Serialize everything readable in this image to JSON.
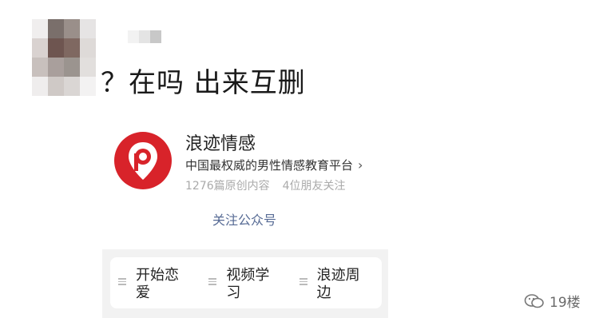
{
  "chat": {
    "message_text": "？在吗 出来互删",
    "avatar_pixels": [
      "#f0eeee",
      "#7a6f6b",
      "#9a8f8a",
      "#e6e4e4",
      "#d9d2d0",
      "#6e5550",
      "#7f6861",
      "#dedad8",
      "#c8c0bd",
      "#a99f9c",
      "#9b948f",
      "#e2dfdd",
      "#efeded",
      "#cfc9c6",
      "#dad6d4",
      "#f3f2f2"
    ],
    "name_blur_pixels": [
      "#f2f2f2",
      "#e4e4e4",
      "#c8c8c8"
    ]
  },
  "official_account": {
    "name": "浪迹情感",
    "description": "中国最权威的男性情感教育平台",
    "chevron": "›",
    "original_count": "1276篇原创内容",
    "friends_following": "4位朋友关注",
    "follow_label": "关注公众号",
    "logo_icon": "location-pin-p-icon",
    "logo_color": "#d8232a"
  },
  "menu": {
    "items": [
      {
        "label": "开始恋爱",
        "icon": "menu-lines-icon"
      },
      {
        "label": "视频学习",
        "icon": "menu-lines-icon"
      },
      {
        "label": "浪迹周边",
        "icon": "menu-lines-icon"
      }
    ]
  },
  "watermark": {
    "label": "19楼",
    "icon": "wechat-channel-icon"
  },
  "colors": {
    "link": "#576b95",
    "brand_red": "#d8232a"
  }
}
